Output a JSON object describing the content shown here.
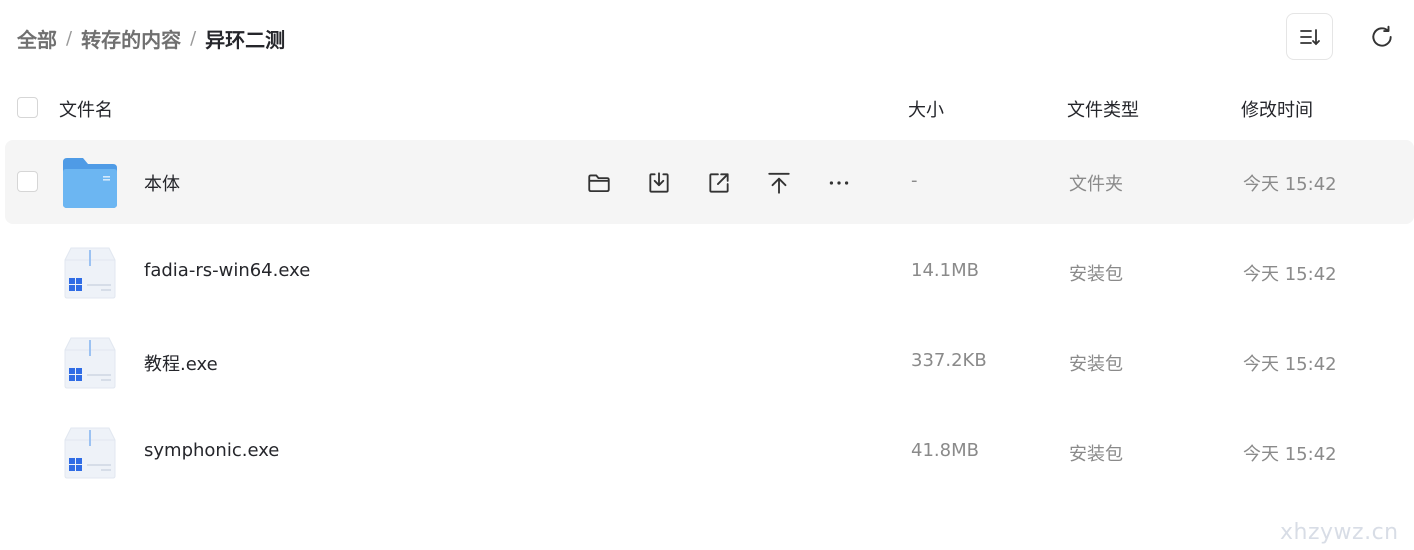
{
  "breadcrumb": {
    "items": [
      {
        "label": "全部"
      },
      {
        "label": "转存的内容"
      },
      {
        "label": "异环二测"
      }
    ],
    "separator": "/"
  },
  "toolbar": {
    "sort_icon": "sort-list-icon",
    "refresh_icon": "refresh-icon"
  },
  "table": {
    "columns": {
      "name": "文件名",
      "size": "大小",
      "type": "文件类型",
      "mtime": "修改时间"
    },
    "rows": [
      {
        "name": "本体",
        "size": "-",
        "type": "文件夹",
        "mtime": "今天 15:42",
        "icon": "folder-icon"
      },
      {
        "name": "fadia-rs-win64.exe",
        "size": "14.1MB",
        "type": "安装包",
        "mtime": "今天 15:42",
        "icon": "installer-icon"
      },
      {
        "name": "教程.exe",
        "size": "337.2KB",
        "type": "安装包",
        "mtime": "今天 15:42",
        "icon": "installer-icon"
      },
      {
        "name": "symphonic.exe",
        "size": "41.8MB",
        "type": "安装包",
        "mtime": "今天 15:42",
        "icon": "installer-icon"
      }
    ],
    "row_actions": [
      "folder-open-icon",
      "download-icon",
      "share-icon",
      "move-to-top-icon",
      "more-icon"
    ]
  },
  "watermark": "xhzywz.cn",
  "colors": {
    "text": "#25262b",
    "muted": "#8a8a8a",
    "hover_row": "#f5f5f5",
    "folder_blue": "#5aa8ee",
    "installer_blue": "#2f6ce5"
  }
}
